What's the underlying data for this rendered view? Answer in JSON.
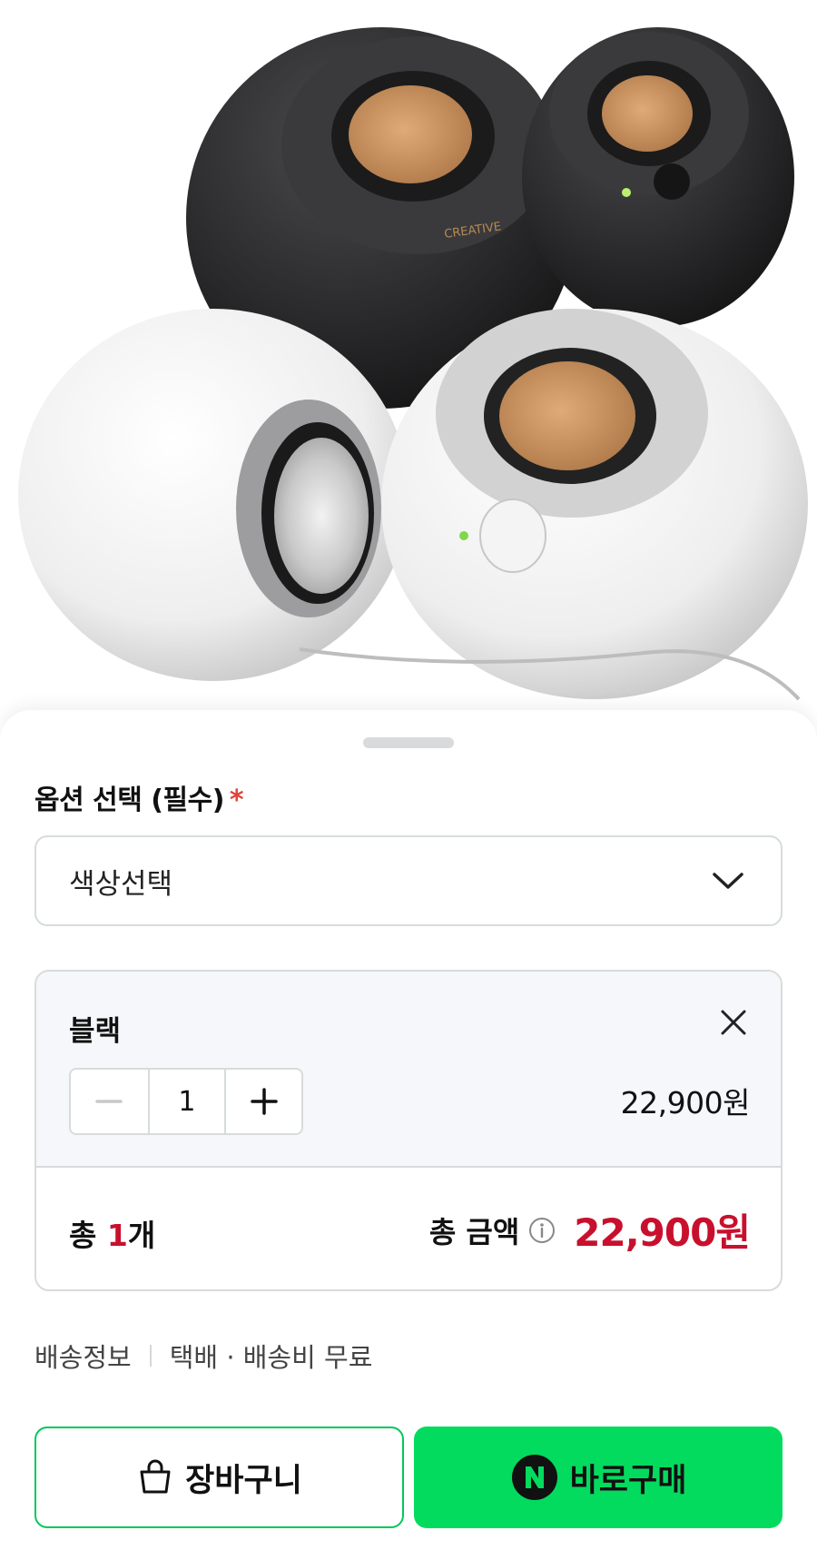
{
  "product": {
    "image_alt": "Creative Pebble speakers in black and white",
    "brand_mark": "CREATIVE"
  },
  "options": {
    "title": "옵션 선택 (필수)",
    "required_mark": "*",
    "select_placeholder": "색상선택"
  },
  "selected_item": {
    "name": "블랙",
    "quantity": "1",
    "price": "22,900원"
  },
  "totals": {
    "count_prefix": "총 ",
    "count_value": "1",
    "count_suffix": "개",
    "amount_label": "총 금액",
    "amount": "22,900원"
  },
  "shipping": {
    "label": "배송정보",
    "detail": "택배 · 배송비 무료"
  },
  "actions": {
    "cart_label": "장바구니",
    "buy_label": "바로구매"
  },
  "colors": {
    "accent_red": "#c8102e",
    "naver_green": "#03db5e"
  }
}
